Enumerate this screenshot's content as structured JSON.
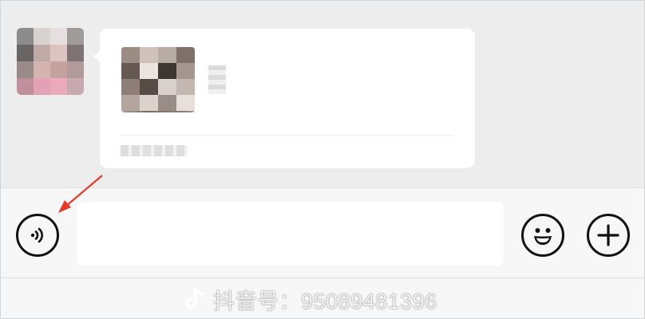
{
  "composer": {
    "voice_icon": "voice-wave-icon",
    "input_value": "",
    "input_placeholder": "",
    "emoji_icon": "smiley-face-icon",
    "plus_icon": "plus-icon"
  },
  "watermark": {
    "logo_icon": "douyin-logo-icon",
    "text": "抖音号：95089481396"
  },
  "annotation": {
    "color": "#e8392b"
  }
}
